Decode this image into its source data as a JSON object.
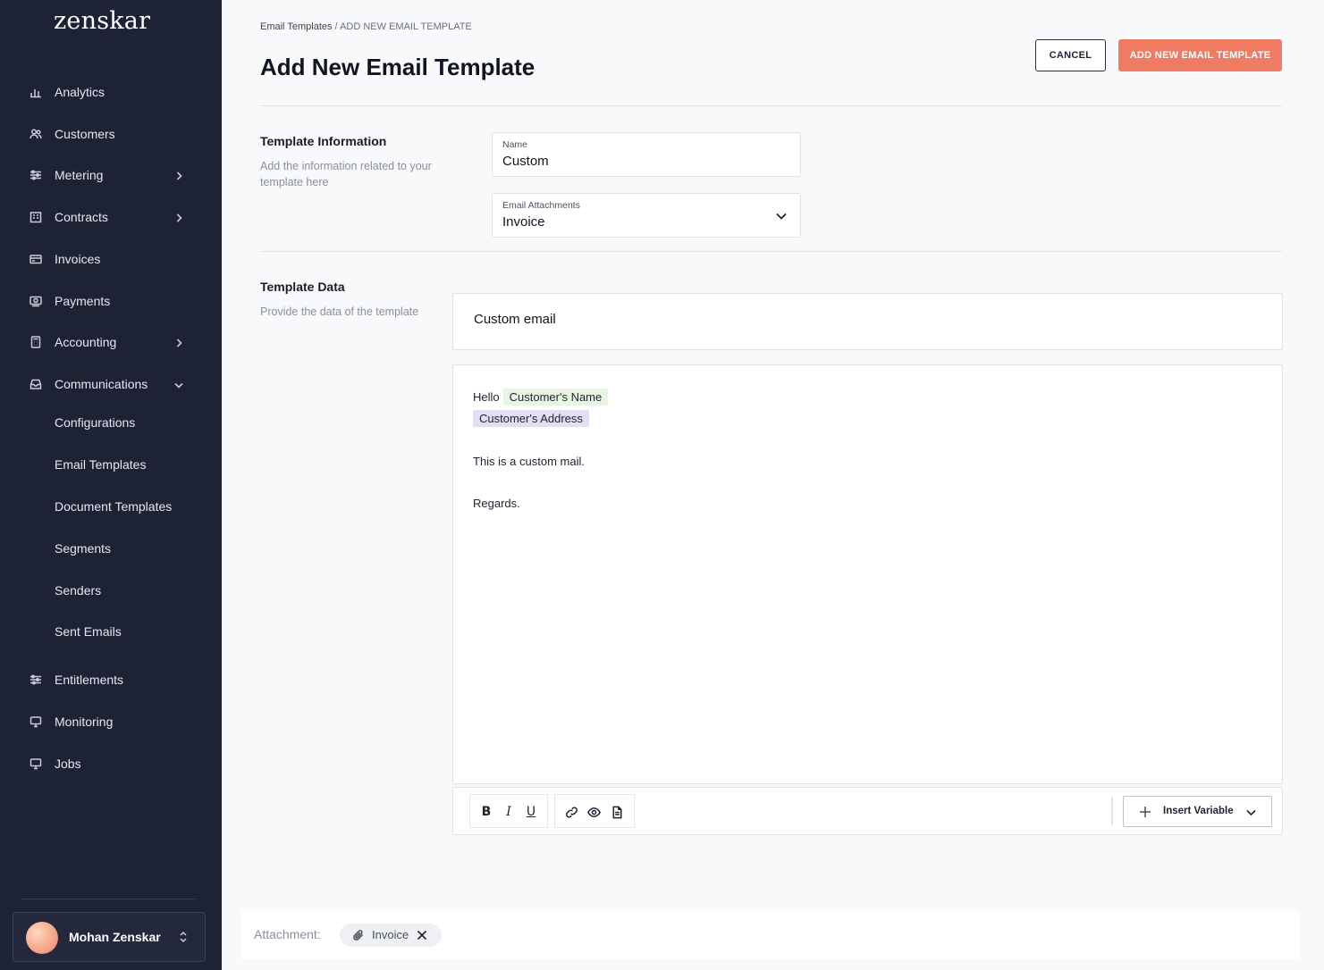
{
  "app": {
    "logo": "zenskar"
  },
  "sidebar": {
    "items": [
      {
        "label": "Analytics",
        "icon": "bar-chart-icon"
      },
      {
        "label": "Customers",
        "icon": "users-icon"
      },
      {
        "label": "Metering",
        "icon": "sliders-icon"
      },
      {
        "label": "Contracts",
        "icon": "building-icon"
      },
      {
        "label": "Invoices",
        "icon": "card-icon"
      },
      {
        "label": "Payments",
        "icon": "cash-icon"
      },
      {
        "label": "Accounting",
        "icon": "calculator-icon"
      },
      {
        "label": "Communications",
        "icon": "inbox-icon"
      }
    ],
    "sub_items": [
      {
        "label": "Configurations"
      },
      {
        "label": "Email Templates"
      },
      {
        "label": "Document Templates"
      },
      {
        "label": "Segments"
      },
      {
        "label": "Senders"
      },
      {
        "label": "Sent Emails"
      }
    ],
    "bottom_items": [
      {
        "label": "Entitlements",
        "icon": "sliders-icon"
      },
      {
        "label": "Monitoring",
        "icon": "monitor-icon"
      },
      {
        "label": "Jobs",
        "icon": "monitor-icon"
      }
    ],
    "user": {
      "name": "Mohan Zenskar"
    }
  },
  "breadcrumb": {
    "parent": "Email Templates",
    "separator": " / ",
    "current": "ADD NEW EMAIL TEMPLATE"
  },
  "header": {
    "title": "Add New Email Template",
    "cancel_label": "CANCEL",
    "submit_label": "ADD NEW EMAIL TEMPLATE"
  },
  "template_info": {
    "title": "Template Information",
    "description": "Add the information related to your template here",
    "name_label": "Name",
    "name_value": "Custom",
    "attachments_label": "Email Attachments",
    "attachments_value": "Invoice"
  },
  "template_data": {
    "title": "Template Data",
    "description": "Provide the data of the template",
    "subject": "Custom email",
    "body": {
      "greeting": "Hello",
      "var_name": "Customer's Name",
      "var_address": "Customer's Address",
      "line1": "This is a custom mail.",
      "line2": "Regards."
    }
  },
  "toolbar": {
    "bold": "B",
    "italic": "I",
    "underline": "U",
    "insert_variable_label": "Insert Variable"
  },
  "attachment_bar": {
    "label": "Attachment:",
    "chip": "Invoice"
  },
  "colors": {
    "sidebar_bg": "#1e2235",
    "accent": "#ef7b62",
    "variable_green": "#e8f5e1",
    "variable_purple": "#e2def5"
  }
}
